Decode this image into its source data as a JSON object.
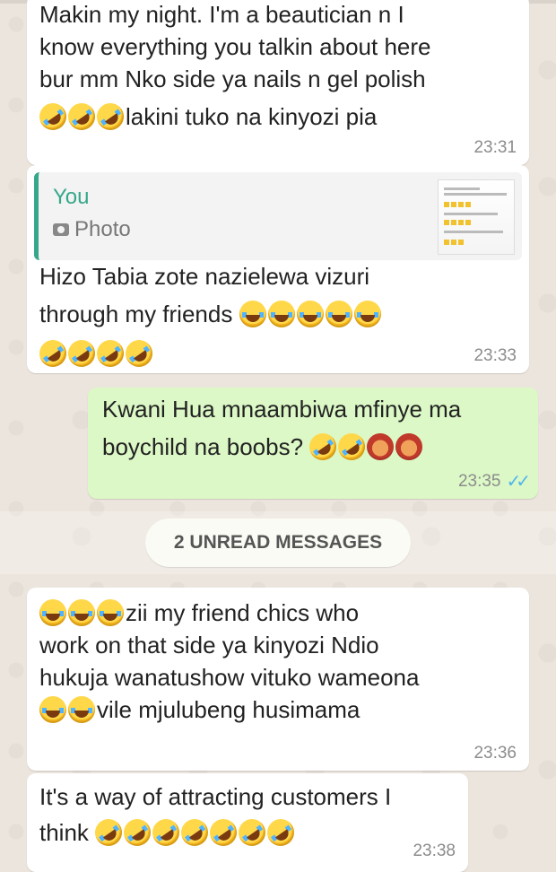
{
  "messages": [
    {
      "direction": "in",
      "lines": [
        "Makin my night. I'm a beautician n I",
        "know everything you talkin about here",
        "bur mm Nko side ya nails n gel polish"
      ],
      "emoji_line_prefix_count": 3,
      "emoji_line_text": "lakini tuko na kinyozi pia",
      "time": "23:31"
    },
    {
      "direction": "in",
      "quote": {
        "name": "You",
        "type": "Photo"
      },
      "line1": "Hizo Tabia zote nazielewa vizuri",
      "line2": "through my friends",
      "time": "23:33"
    },
    {
      "direction": "out",
      "line1": "Kwani Hua mnaambiwa mfinye ma",
      "line2": "boychild na boobs?",
      "time": "23:35"
    },
    {
      "direction": "in",
      "line1": "zii my friend chics who",
      "line2": "work on that side ya kinyozi Ndio",
      "line3": "hukuja wanatushow vituko wameona",
      "line4": "vile mjulubeng husimama",
      "time": "23:36"
    },
    {
      "direction": "in",
      "line1": "It's a way of attracting customers I",
      "line2": "think",
      "time": "23:38"
    }
  ],
  "unread_label": "2 UNREAD MESSAGES",
  "colors": {
    "incoming": "#ffffff",
    "outgoing": "#dcf8c6",
    "quote_accent": "#35a78a",
    "read_ticks": "#4fb6ec",
    "wallpaper": "#ece5dd"
  }
}
